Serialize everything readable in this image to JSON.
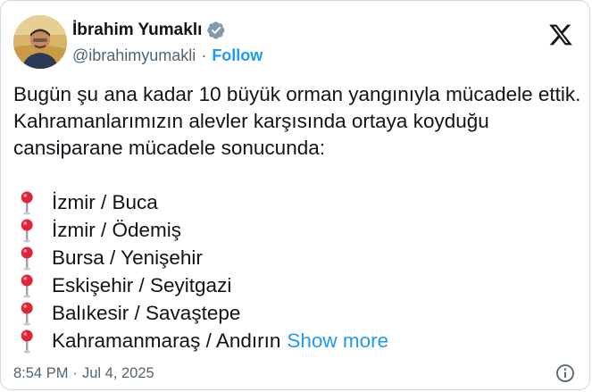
{
  "author": {
    "display_name": "İbrahim Yumaklı",
    "handle": "@ibrahimyumakli",
    "separator": "·",
    "follow_label": "Follow",
    "verified_icon": "verified-badge-icon",
    "avatar": "profile-photo"
  },
  "brand": {
    "logo_icon": "x-logo-icon"
  },
  "post": {
    "intro": "Bugün şu ana kadar 10 büyük orman yangınıyla mücadele ettik. Kahramanlarımızın alevler karşısında ortaya koyduğu cansiparane mücadele sonucunda:",
    "locations": [
      "İzmir / Buca",
      "İzmir / Ödemiş",
      "Bursa / Yenişehir",
      "Eskişehir / Seyitgazi",
      "Balıkesir / Savaştepe",
      "Kahramanmaraş / Andırın"
    ],
    "location_icon": "round-pushpin-icon",
    "show_more_label": "Show more"
  },
  "footer": {
    "time": "8:54 PM",
    "separator": "·",
    "date": "Jul 4, 2025",
    "info_icon": "info-icon"
  },
  "colors": {
    "link": "#1d9bf0",
    "secondary_text": "#536471",
    "text": "#0f1419",
    "border": "#cfd9de",
    "pin_red": "#e0243a"
  }
}
